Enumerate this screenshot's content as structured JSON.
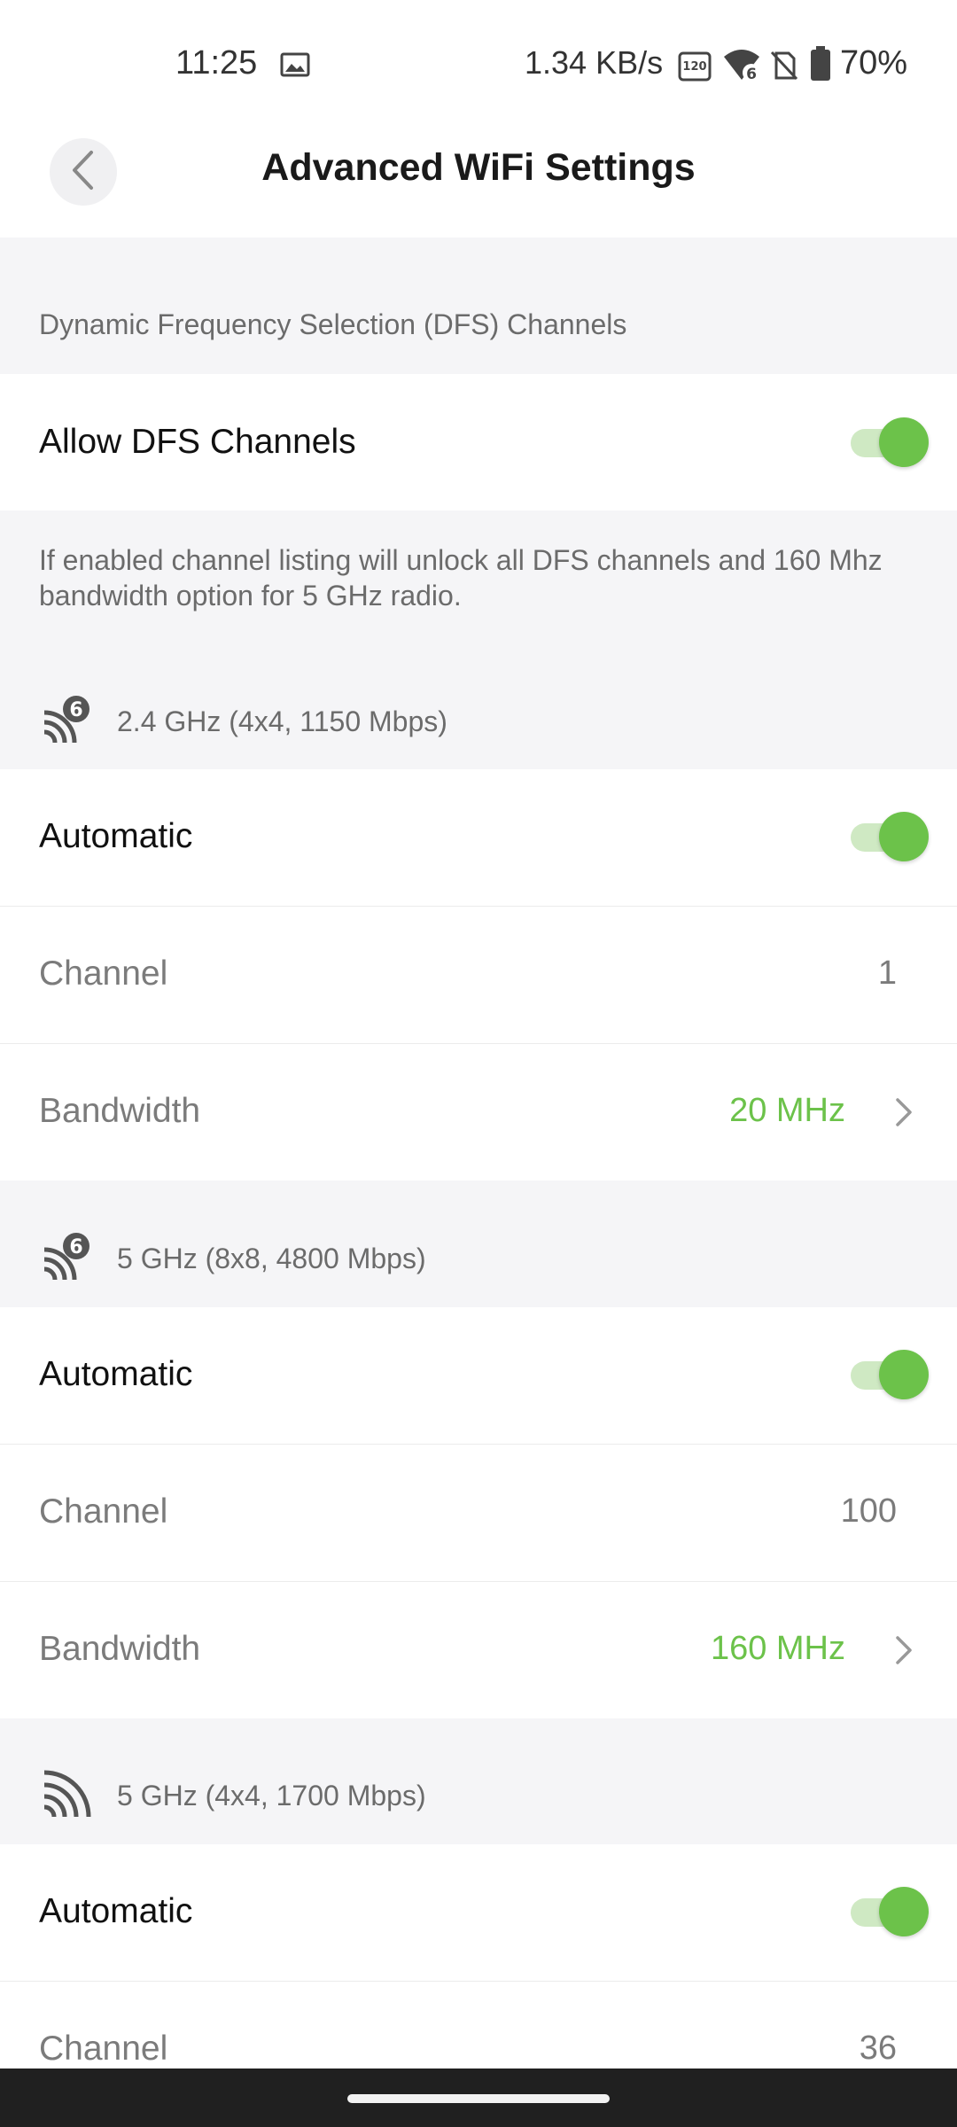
{
  "status_bar": {
    "time": "11:25",
    "net_speed": "1.34 KB/s",
    "battery": "70%",
    "icons": [
      "image-icon",
      "refresh-rate-icon",
      "wifi-6-icon",
      "no-sim-icon",
      "battery-icon"
    ]
  },
  "header": {
    "title": "Advanced WiFi Settings",
    "back_icon": "chevron-left-icon"
  },
  "dfs": {
    "section_label": "Dynamic Frequency Selection (DFS) Channels",
    "toggle_label": "Allow DFS Channels",
    "toggle_on": true,
    "description": "If enabled channel listing will unlock all DFS channels and 160 Mhz bandwidth option for 5 GHz radio."
  },
  "radios": [
    {
      "icon": "wifi-6-icon",
      "label": "2.4 GHz (4x4, 1150 Mbps)",
      "automatic_label": "Automatic",
      "automatic_on": true,
      "channel_label": "Channel",
      "channel_value": "1",
      "bandwidth_label": "Bandwidth",
      "bandwidth_value": "20 MHz"
    },
    {
      "icon": "wifi-6-icon",
      "label": "5 GHz (8x8, 4800 Mbps)",
      "automatic_label": "Automatic",
      "automatic_on": true,
      "channel_label": "Channel",
      "channel_value": "100",
      "bandwidth_label": "Bandwidth",
      "bandwidth_value": "160 MHz"
    },
    {
      "icon": "wifi-icon",
      "label": "5 GHz (4x4, 1700 Mbps)",
      "automatic_label": "Automatic",
      "automatic_on": true,
      "channel_label": "Channel",
      "channel_value": "36"
    }
  ],
  "colors": {
    "accent": "#6cc24a",
    "accent_light": "#cfe9c3",
    "background": "#f5f5f7"
  }
}
